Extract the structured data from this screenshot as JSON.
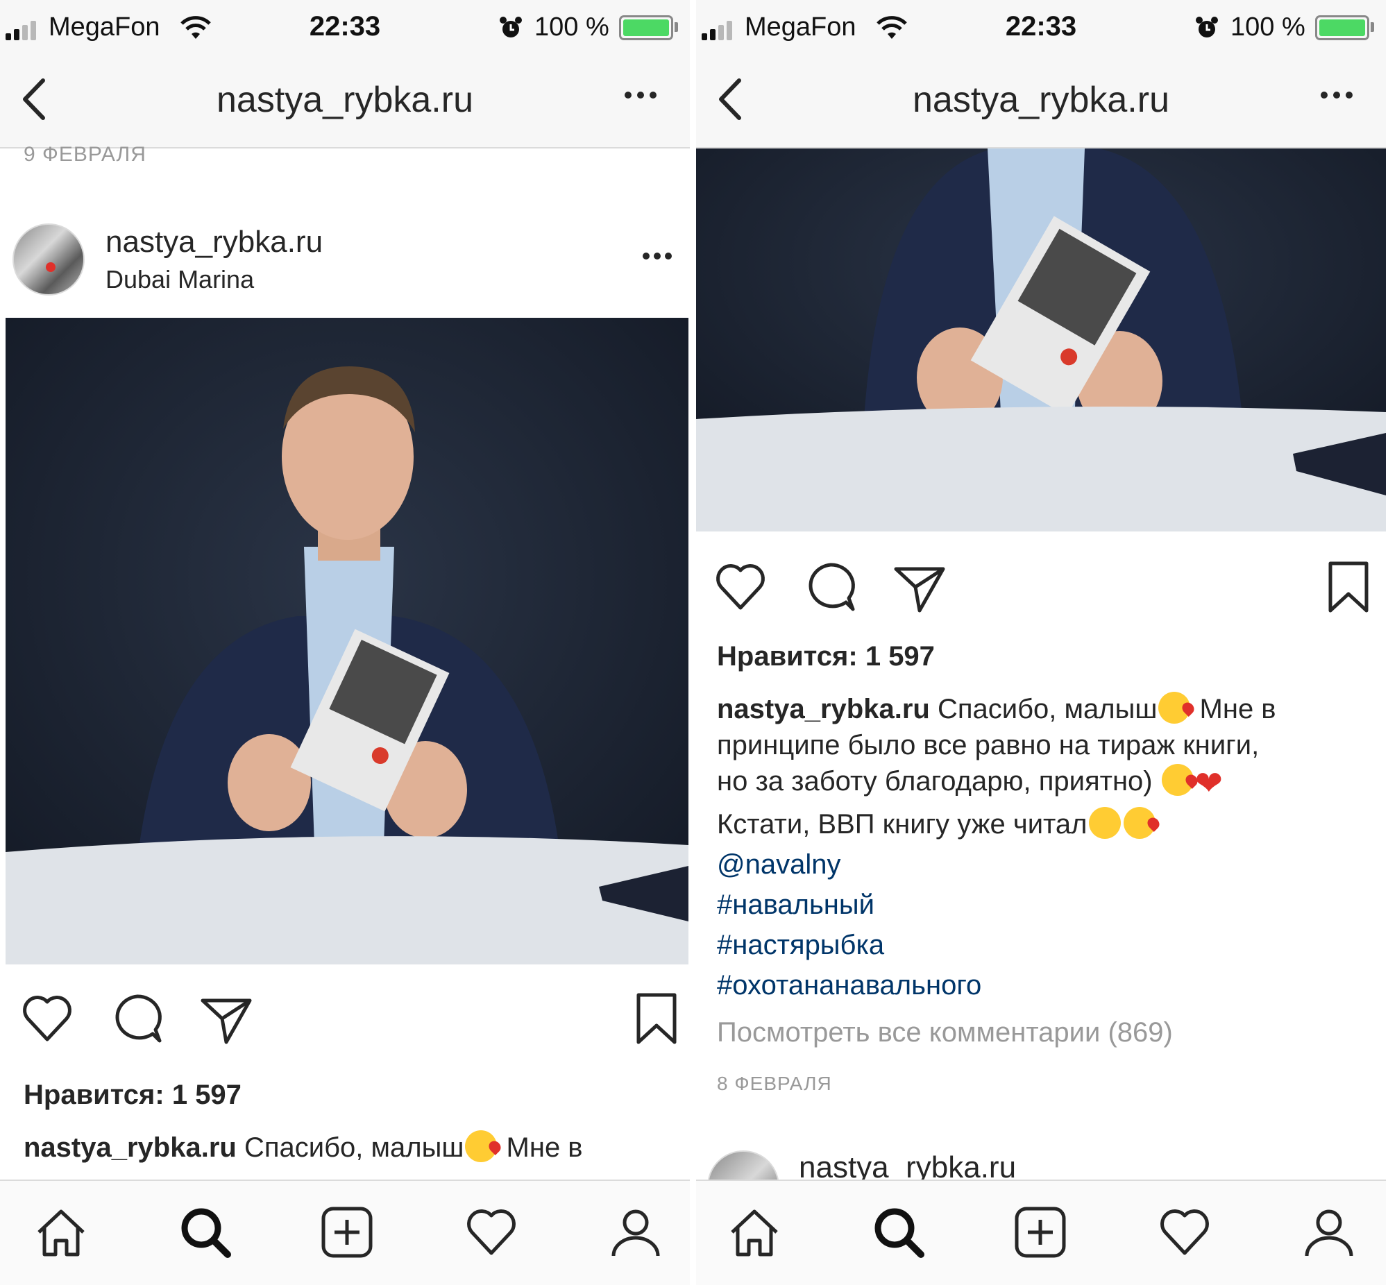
{
  "status_bar": {
    "carrier": "MegaFon",
    "time": "22:33",
    "battery": "100 %"
  },
  "nav": {
    "title": "nastya_rybka.ru"
  },
  "left": {
    "date_top": "9 ФЕВРАЛЯ",
    "post_author": "nastya_rybka.ru",
    "post_location": "Dubai Marina",
    "likes": "Нравится: 1 597",
    "caption_user": "nastya_rybka.ru",
    "caption_line1": "Спасибо, малыш",
    "caption_line1_end": " Мне в"
  },
  "right": {
    "likes": "Нравится: 1 597",
    "caption_user": "nastya_rybka.ru",
    "caption_line1": "Спасибо, малыш",
    "caption_line1_end": " Мне в",
    "caption_line2": "принципе было все равно на тираж книги,",
    "caption_line3": "но за заботу благодарю, приятно) ",
    "caption_line4": "Кстати, ВВП книгу уже читал",
    "mention": "@navalny",
    "hashtags": [
      "#навальный",
      "#настярыбка",
      "#охотананавального"
    ],
    "view_comments": "Посмотреть все комментарии (869)",
    "post_date": "8 ФЕВРАЛЯ",
    "next_author": "nastya_rybka.ru"
  },
  "icons": {
    "back": "chevron-left-icon",
    "more": "more-dots-icon",
    "like": "heart-icon",
    "comment": "comment-bubble-icon",
    "share": "paper-plane-icon",
    "save": "bookmark-icon",
    "tabs": [
      "home-icon",
      "search-icon",
      "add-post-icon",
      "activity-heart-icon",
      "profile-icon"
    ]
  },
  "colors": {
    "link": "#003569",
    "muted": "#999999",
    "battery": "#4cd964",
    "photo_bg": "#1a2130"
  }
}
